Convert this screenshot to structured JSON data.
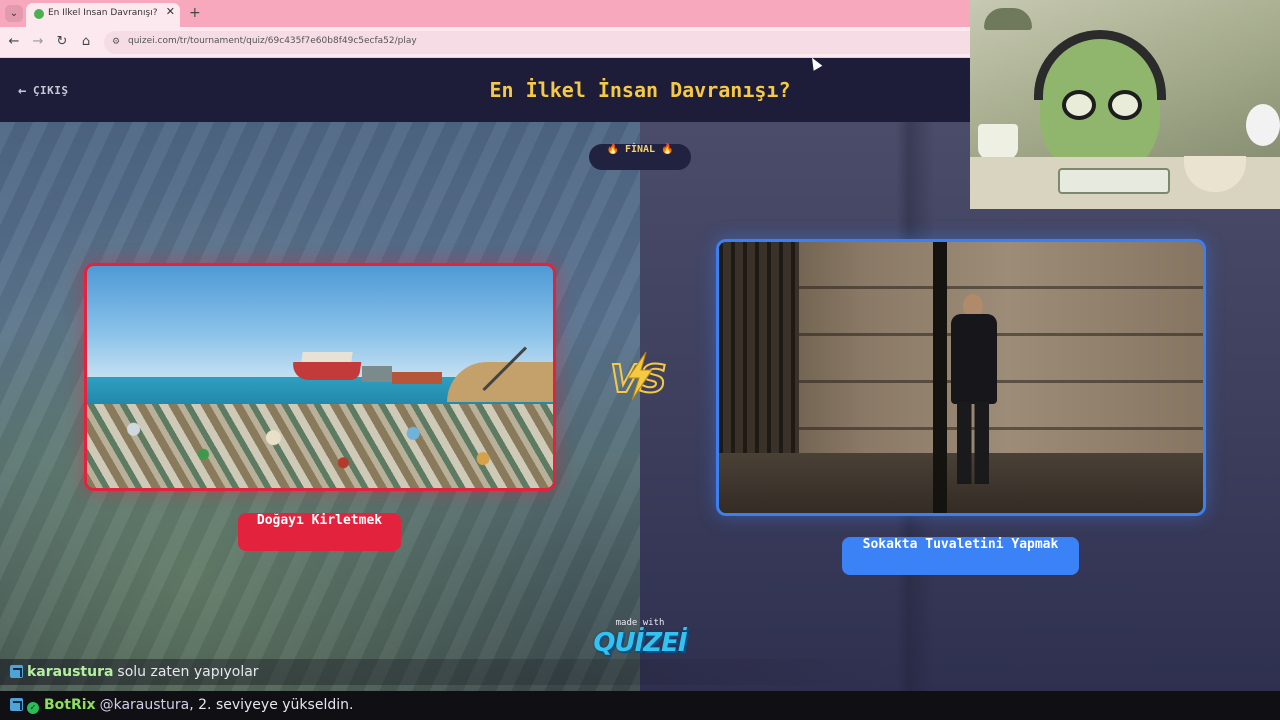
{
  "browser": {
    "tab_title": "En İlkel İnsan Davranışı? - Tier L",
    "tab_close": "✕",
    "new_tab": "+",
    "tab_menu": "⌄",
    "url": "quizei.com/tr/tournament/quiz/69c435f7e60b8f49c5ecfa52/play",
    "nav": {
      "back": "←",
      "forward": "→",
      "reload": "↻",
      "home": "⌂",
      "site_info": "⚙"
    }
  },
  "header": {
    "exit_label": "ÇIKIŞ",
    "exit_icon": "←",
    "title": "En İlkel İnsan Davranışı?"
  },
  "round": {
    "badge": "🔥 FİNAL 🔥"
  },
  "choices": [
    {
      "label": "Doğayı Kirletmek",
      "color": "#e3223d"
    },
    {
      "label": "Sokakta Tuvaletini Yapmak",
      "color": "#3b82f6"
    }
  ],
  "versus": {
    "text": "VS",
    "accent": "#f6c945"
  },
  "branding": {
    "made_with": "made with",
    "brand": "QUİZEİ"
  },
  "chat": [
    {
      "user": "karaustura",
      "message": "solu zaten yapıyolar"
    },
    {
      "user": "BotRix",
      "mention": "@karaustura",
      "message": ", 2. seviyeye yükseldin."
    }
  ]
}
